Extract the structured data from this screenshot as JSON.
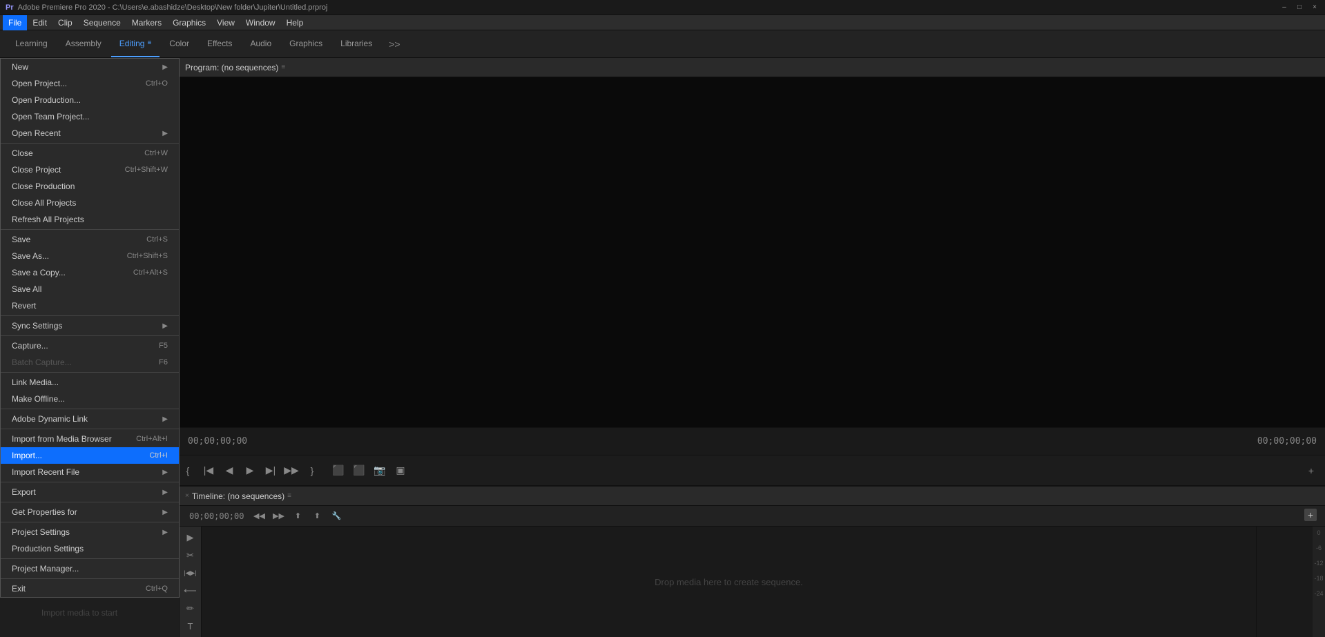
{
  "titlebar": {
    "title": "Adobe Premiere Pro 2020 - C:\\Users\\e.abashidze\\Desktop\\New folder\\Jupiter\\Untitled.prproj",
    "min_btn": "–",
    "max_btn": "□",
    "close_btn": "×"
  },
  "menubar": {
    "items": [
      {
        "label": "File",
        "active": true
      },
      {
        "label": "Edit",
        "active": false
      },
      {
        "label": "Clip",
        "active": false
      },
      {
        "label": "Sequence",
        "active": false
      },
      {
        "label": "Markers",
        "active": false
      },
      {
        "label": "Graphics",
        "active": false
      },
      {
        "label": "View",
        "active": false
      },
      {
        "label": "Window",
        "active": false
      },
      {
        "label": "Help",
        "active": false
      }
    ]
  },
  "workspace_tabs": {
    "tabs": [
      {
        "label": "Learning",
        "active": false
      },
      {
        "label": "Assembly",
        "active": false
      },
      {
        "label": "Editing",
        "active": true
      },
      {
        "label": "Color",
        "active": false
      },
      {
        "label": "Effects",
        "active": false
      },
      {
        "label": "Audio",
        "active": false
      },
      {
        "label": "Graphics",
        "active": false
      },
      {
        "label": "Libraries",
        "active": false
      }
    ],
    "more_label": ">>"
  },
  "file_menu": {
    "items": [
      {
        "id": "new",
        "label": "New",
        "shortcut": "",
        "has_arrow": true,
        "disabled": false,
        "separator_after": false
      },
      {
        "id": "open_project",
        "label": "Open Project...",
        "shortcut": "Ctrl+O",
        "has_arrow": false,
        "disabled": false,
        "separator_after": false
      },
      {
        "id": "open_production",
        "label": "Open Production...",
        "shortcut": "",
        "has_arrow": false,
        "disabled": false,
        "separator_after": false
      },
      {
        "id": "open_team_project",
        "label": "Open Team Project...",
        "shortcut": "",
        "has_arrow": false,
        "disabled": false,
        "separator_after": false
      },
      {
        "id": "open_recent",
        "label": "Open Recent",
        "shortcut": "",
        "has_arrow": true,
        "disabled": false,
        "separator_after": true
      },
      {
        "id": "close",
        "label": "Close",
        "shortcut": "Ctrl+W",
        "has_arrow": false,
        "disabled": false,
        "separator_after": false
      },
      {
        "id": "close_project",
        "label": "Close Project",
        "shortcut": "Ctrl+Shift+W",
        "has_arrow": false,
        "disabled": false,
        "separator_after": false
      },
      {
        "id": "close_production",
        "label": "Close Production",
        "shortcut": "",
        "has_arrow": false,
        "disabled": false,
        "separator_after": false
      },
      {
        "id": "close_all_projects",
        "label": "Close All Projects",
        "shortcut": "",
        "has_arrow": false,
        "disabled": false,
        "separator_after": false
      },
      {
        "id": "refresh_all_projects",
        "label": "Refresh All Projects",
        "shortcut": "",
        "has_arrow": false,
        "disabled": false,
        "separator_after": true
      },
      {
        "id": "save",
        "label": "Save",
        "shortcut": "Ctrl+S",
        "has_arrow": false,
        "disabled": false,
        "separator_after": false
      },
      {
        "id": "save_as",
        "label": "Save As...",
        "shortcut": "Ctrl+Shift+S",
        "has_arrow": false,
        "disabled": false,
        "separator_after": false
      },
      {
        "id": "save_copy",
        "label": "Save a Copy...",
        "shortcut": "Ctrl+Alt+S",
        "has_arrow": false,
        "disabled": false,
        "separator_after": false
      },
      {
        "id": "save_all",
        "label": "Save All",
        "shortcut": "",
        "has_arrow": false,
        "disabled": false,
        "separator_after": false
      },
      {
        "id": "revert",
        "label": "Revert",
        "shortcut": "",
        "has_arrow": false,
        "disabled": false,
        "separator_after": true
      },
      {
        "id": "sync_settings",
        "label": "Sync Settings",
        "shortcut": "",
        "has_arrow": true,
        "disabled": false,
        "separator_after": true
      },
      {
        "id": "capture",
        "label": "Capture...",
        "shortcut": "F5",
        "has_arrow": false,
        "disabled": false,
        "separator_after": false
      },
      {
        "id": "batch_capture",
        "label": "Batch Capture...",
        "shortcut": "F6",
        "has_arrow": false,
        "disabled": true,
        "separator_after": true
      },
      {
        "id": "link_media",
        "label": "Link Media...",
        "shortcut": "",
        "has_arrow": false,
        "disabled": false,
        "separator_after": false
      },
      {
        "id": "make_offline",
        "label": "Make Offline...",
        "shortcut": "",
        "has_arrow": false,
        "disabled": false,
        "separator_after": true
      },
      {
        "id": "adobe_dynamic_link",
        "label": "Adobe Dynamic Link",
        "shortcut": "",
        "has_arrow": true,
        "disabled": false,
        "separator_after": true
      },
      {
        "id": "import_from_media",
        "label": "Import from Media Browser",
        "shortcut": "Ctrl+Alt+I",
        "has_arrow": false,
        "disabled": false,
        "separator_after": false
      },
      {
        "id": "import",
        "label": "Import...",
        "shortcut": "Ctrl+I",
        "has_arrow": false,
        "disabled": false,
        "highlighted": true,
        "separator_after": false
      },
      {
        "id": "import_recent",
        "label": "Import Recent File",
        "shortcut": "",
        "has_arrow": true,
        "disabled": false,
        "separator_after": true
      },
      {
        "id": "export",
        "label": "Export",
        "shortcut": "",
        "has_arrow": true,
        "disabled": false,
        "separator_after": true
      },
      {
        "id": "get_properties",
        "label": "Get Properties for",
        "shortcut": "",
        "has_arrow": true,
        "disabled": false,
        "separator_after": true
      },
      {
        "id": "project_settings",
        "label": "Project Settings",
        "shortcut": "",
        "has_arrow": true,
        "disabled": false,
        "separator_after": false
      },
      {
        "id": "production_settings",
        "label": "Production Settings",
        "shortcut": "",
        "has_arrow": false,
        "disabled": false,
        "separator_after": true
      },
      {
        "id": "project_manager",
        "label": "Project Manager...",
        "shortcut": "",
        "has_arrow": false,
        "disabled": false,
        "separator_after": true
      },
      {
        "id": "exit",
        "label": "Exit",
        "shortcut": "Ctrl+Q",
        "has_arrow": false,
        "disabled": false,
        "separator_after": false
      }
    ]
  },
  "program_monitor": {
    "header": "Program: (no sequences)",
    "timecode_left": "00;00;00;00",
    "timecode_right": "00;00;00;00"
  },
  "timeline": {
    "header": "Timeline: (no sequences)",
    "timecode": "00;00;00;00",
    "drop_hint": "Drop media here to create sequence.",
    "import_hint": "Import media to start"
  },
  "tools": {
    "items": [
      {
        "icon": "▶",
        "name": "selection-tool"
      },
      {
        "icon": "✂",
        "name": "razor-tool"
      },
      {
        "icon": "|◀▶|",
        "name": "ripple-edit-tool"
      },
      {
        "icon": "⟵",
        "name": "track-select-tool"
      },
      {
        "icon": "✏",
        "name": "pen-tool"
      },
      {
        "icon": "T",
        "name": "text-tool"
      }
    ]
  },
  "mini_panel": {
    "scale_values": [
      "0",
      "-6",
      "-12",
      "-18",
      "-24"
    ]
  },
  "add_track": "+"
}
